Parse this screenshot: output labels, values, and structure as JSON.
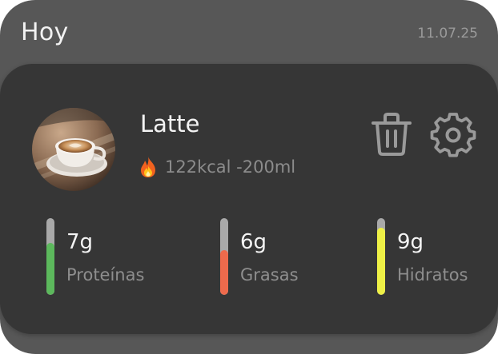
{
  "header": {
    "title": "Hoy",
    "date": "11.07.25"
  },
  "entry": {
    "name": "Latte",
    "calories_text": "122kcal -200ml",
    "image_icon": "latte-coffee-cup",
    "meta_icon": "fire-icon",
    "actions": [
      {
        "name": "delete",
        "icon": "trash-icon"
      },
      {
        "name": "settings",
        "icon": "gear-icon"
      }
    ]
  },
  "macros": [
    {
      "value": "7g",
      "label": "Proteínas",
      "color": "#5cb85c",
      "fill_fraction": 0.68
    },
    {
      "value": "6g",
      "label": "Grasas",
      "color": "#ee6a4c",
      "fill_fraction": 0.58
    },
    {
      "value": "9g",
      "label": "Hidratos",
      "color": "#eef046",
      "fill_fraction": 0.88
    }
  ],
  "colors": {
    "outer_card": "#575757",
    "inner_card": "#363636",
    "icon_stroke": "#9a9a9a",
    "bar_track": "#a9a9a9"
  }
}
